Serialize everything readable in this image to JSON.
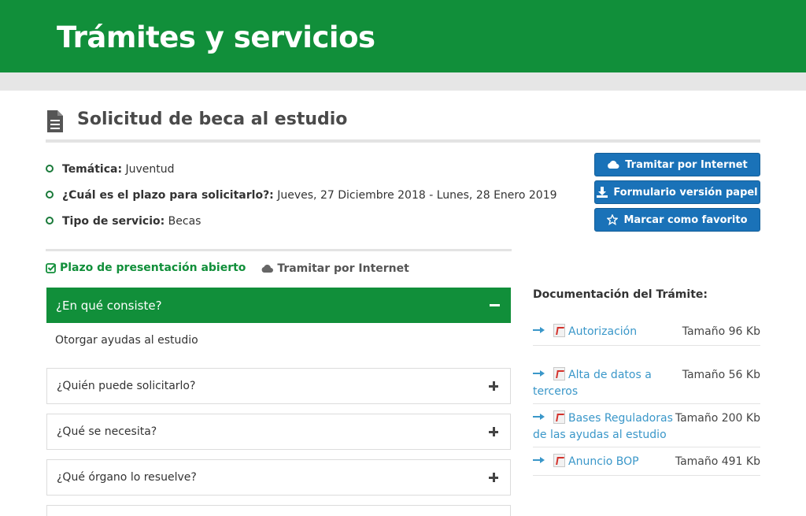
{
  "header": {
    "title": "Trámites y servicios"
  },
  "page": {
    "title": "Solicitud de beca al estudio",
    "title_icon": "document-icon"
  },
  "info": [
    {
      "label": "Temática:",
      "value": " Juventud"
    },
    {
      "label": "¿Cuál es el plazo para solicitarlo?:",
      "value": " Jueves, 27 Diciembre 2018 - Lunes, 28 Enero 2019"
    },
    {
      "label": "Tipo de servicio:",
      "value": " Becas"
    }
  ],
  "actions": [
    {
      "label": "Tramitar por Internet",
      "icon": "cloud-icon"
    },
    {
      "label": "Formulario versión papel",
      "icon": "download-icon"
    },
    {
      "label": "Marcar como favorito",
      "icon": "star-icon"
    }
  ],
  "status": {
    "open_label": "Plazo de presentación abierto",
    "internet_label": "Tramitar por Internet"
  },
  "accordion": {
    "open_title": "¿En qué consiste?",
    "open_body": "Otorgar ayudas al estudio",
    "items": [
      "¿Quién puede solicitarlo?",
      "¿Qué se necesita?",
      "¿Qué órgano lo resuelve?"
    ]
  },
  "docs": {
    "heading": "Documentación del Trámite:",
    "items": [
      {
        "name": "Autorización",
        "size": "Tamaño 96 Kb"
      },
      {
        "name": "Alta de datos a terceros",
        "size": "Tamaño 56 Kb"
      },
      {
        "name": "Bases Reguladoras de las ayudas al estudio",
        "size": "Tamaño 200 Kb"
      },
      {
        "name": "Anuncio BOP",
        "size": "Tamaño 491 Kb"
      }
    ]
  },
  "colors": {
    "brand_green": "#118f3a",
    "button_blue": "#1a72b8",
    "link_blue": "#3a97c9"
  }
}
